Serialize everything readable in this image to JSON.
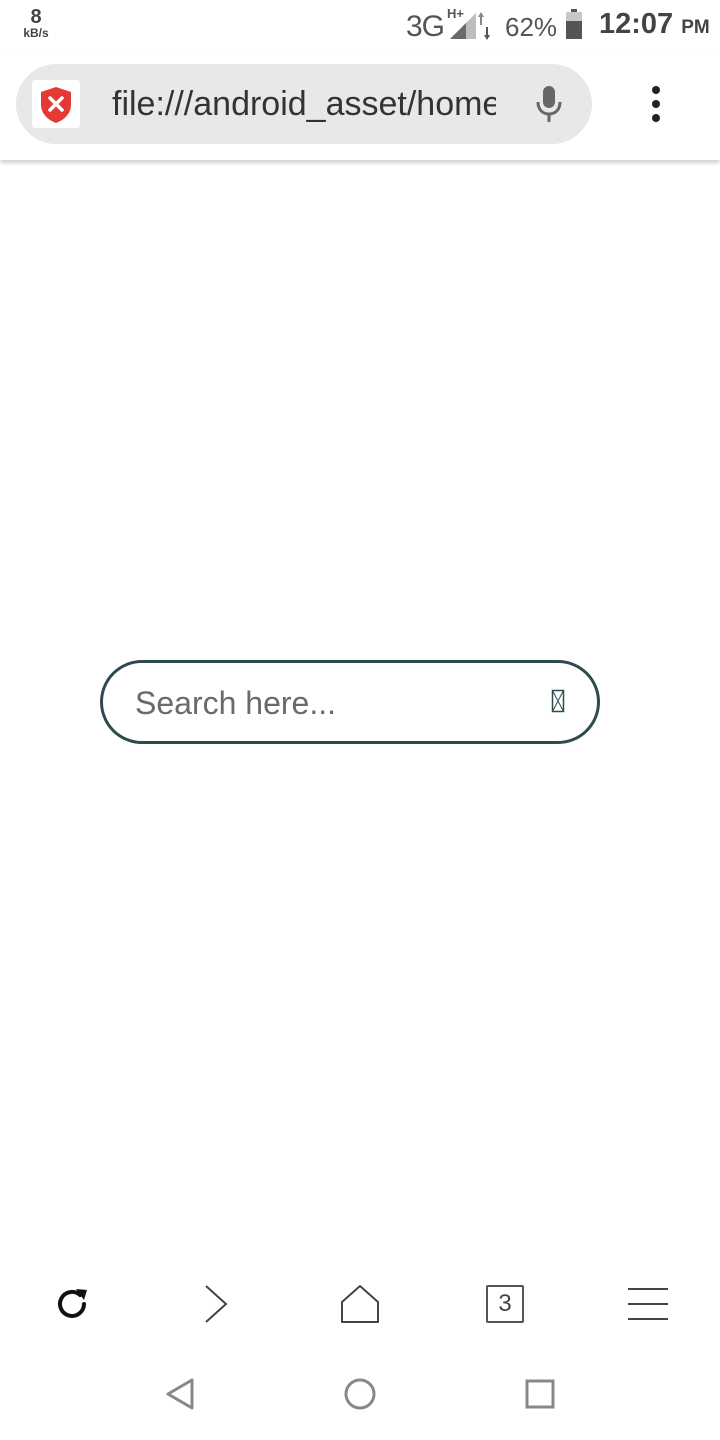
{
  "status_bar": {
    "net_speed_value": "8",
    "net_speed_unit": "kB/s",
    "network_type": "3G",
    "network_sup": "H+",
    "battery_percent": "62%",
    "time": "12:07",
    "ampm": "PM"
  },
  "url_bar": {
    "url": "file:///android_asset/home"
  },
  "search": {
    "placeholder": "Search here..."
  },
  "toolbar": {
    "tab_count": "3"
  },
  "icons": {
    "site_security": "shield-x-icon",
    "voice": "mic-icon",
    "overflow": "more-vert-icon",
    "reload": "reload-icon",
    "forward": "forward-icon",
    "home": "home-icon",
    "tabs": "tabs-icon",
    "menu": "hamburger-icon",
    "back_nav": "back-triangle-icon",
    "home_nav": "home-circle-icon",
    "recents_nav": "recents-square-icon"
  },
  "colors": {
    "search_border": "#2e4a50",
    "shield": "#e53935",
    "urlbar_bg": "#e8e8ea"
  }
}
